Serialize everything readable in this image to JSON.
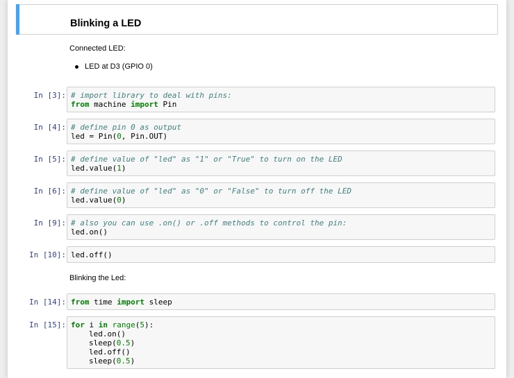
{
  "heading": "Blinking a LED",
  "markdown": {
    "connected": "Connected LED:",
    "bullet": "LED at D3 (GPIO 0)",
    "blinking": "Blinking the Led:"
  },
  "cells": [
    {
      "prompt": "In [3]:",
      "lines": [
        {
          "comment": "# import library to deal with pins:"
        },
        {
          "kw1": "from",
          "t1": " machine ",
          "kw2": "import",
          "t2": " Pin"
        }
      ]
    },
    {
      "prompt": "In [4]:",
      "lines": [
        {
          "comment": "# define pin 0 as output"
        },
        {
          "text": "led = Pin(",
          "num": "0",
          "rest": ", Pin.OUT)"
        }
      ]
    },
    {
      "prompt": "In [5]:",
      "lines": [
        {
          "comment": "# define value of \"led\" as \"1\" or \"True\" to turn on the LED"
        },
        {
          "text": "led.value(",
          "num": "1",
          "rest": ")"
        }
      ]
    },
    {
      "prompt": "In [6]:",
      "lines": [
        {
          "comment": "# define value of \"led\" as \"0\" or \"False\" to turn off the LED"
        },
        {
          "text": "led.value(",
          "num": "0",
          "rest": ")"
        }
      ]
    },
    {
      "prompt": "In [9]:",
      "lines": [
        {
          "comment": "# also you can use .on() or .off methods to control the pin:"
        },
        {
          "text": "led.on()"
        }
      ]
    },
    {
      "prompt": "In [10]:",
      "lines": [
        {
          "text": "led.off()"
        }
      ]
    },
    {
      "prompt": "In [14]:",
      "lines": [
        {
          "kw1": "from",
          "t1": " time ",
          "kw2": "import",
          "t2": " sleep"
        }
      ]
    },
    {
      "prompt": "In [15]:",
      "lines": [
        {
          "kw1": "for",
          "t1": " i ",
          "kw2": "in",
          "bi": " range",
          "t2": "(",
          "num": "5",
          "rest": "):"
        },
        {
          "text": "led.on()"
        },
        {
          "text": "sleep(",
          "num": "0.5",
          "rest": ")"
        },
        {
          "text": "led.off()"
        },
        {
          "text": "sleep(",
          "num": "0.5",
          "rest": ")"
        }
      ]
    }
  ]
}
